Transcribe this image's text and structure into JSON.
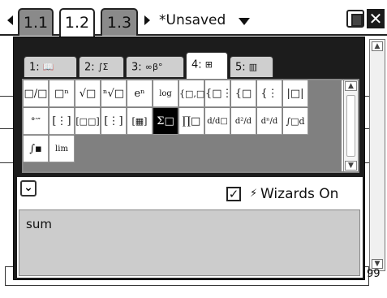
{
  "header": {
    "tabs": [
      {
        "label": "1.1",
        "active": false
      },
      {
        "label": "1.2",
        "active": true
      },
      {
        "label": "1.3",
        "active": false
      }
    ],
    "document_title": "*Unsaved",
    "icons": [
      "nav-left-arrow-icon",
      "nav-right-arrow-icon",
      "dropdown-arrow-icon",
      "battery-icon",
      "close-icon"
    ],
    "close_glyph": "✕"
  },
  "background": {
    "entry_value": "99",
    "scroll_up": "▲",
    "scroll_down": "▼"
  },
  "catalog": {
    "tabs": [
      {
        "number": "1:",
        "icon": "book-icon",
        "glyph": "📖",
        "active": false
      },
      {
        "number": "2:",
        "icon": "integral-sigma-icon",
        "glyph": "∫Σ",
        "active": false
      },
      {
        "number": "3:",
        "icon": "infinity-beta-icon",
        "glyph": "∞β°",
        "active": false
      },
      {
        "number": "4:",
        "icon": "template-icon",
        "glyph": "⊞",
        "active": true
      },
      {
        "number": "5:",
        "icon": "library-icon",
        "glyph": "▥",
        "active": false
      }
    ],
    "templates_row1": [
      {
        "icon": "fraction-template-icon",
        "glyph": "□/□"
      },
      {
        "icon": "exponent-template-icon",
        "glyph": "□ⁿ"
      },
      {
        "icon": "square-root-template-icon",
        "glyph": "√□"
      },
      {
        "icon": "nth-root-template-icon",
        "glyph": "ⁿ√□"
      },
      {
        "icon": "e-exponent-template-icon",
        "glyph": "eⁿ"
      },
      {
        "icon": "log-template-icon",
        "glyph": "log"
      },
      {
        "icon": "piecewise-2-template-icon",
        "glyph": "{□,□"
      },
      {
        "icon": "piecewise-n-template-icon",
        "glyph": "{□⋮"
      },
      {
        "icon": "system-2-template-icon",
        "glyph": "{□"
      },
      {
        "icon": "system-n-template-icon",
        "glyph": "{⋮"
      },
      {
        "icon": "absolute-value-template-icon",
        "glyph": "|□|"
      }
    ],
    "templates_row2": [
      {
        "icon": "degree-minute-second-template-icon",
        "glyph": "°′″"
      },
      {
        "icon": "matrix-2x2-template-icon",
        "glyph": "[⋮]"
      },
      {
        "icon": "row-vector-template-icon",
        "glyph": "[□□]"
      },
      {
        "icon": "column-vector-template-icon",
        "glyph": "[⋮]"
      },
      {
        "icon": "matrix-mxn-template-icon",
        "glyph": "[▦]"
      },
      {
        "icon": "sum-template-icon",
        "glyph": "Σ□",
        "selected": true
      },
      {
        "icon": "product-template-icon",
        "glyph": "∏□"
      },
      {
        "icon": "derivative-template-icon",
        "glyph": "d/d□"
      },
      {
        "icon": "second-derivative-template-icon",
        "glyph": "d²/d"
      },
      {
        "icon": "nth-derivative-template-icon",
        "glyph": "dⁿ/d"
      },
      {
        "icon": "definite-integral-template-icon",
        "glyph": "∫□d"
      }
    ],
    "templates_row3": [
      {
        "icon": "indefinite-integral-template-icon",
        "glyph": "∫▪"
      },
      {
        "icon": "limit-template-icon",
        "glyph": "lim"
      }
    ],
    "wizards": {
      "checked": true,
      "check_glyph": "✓",
      "icon": "wizard-wand-icon",
      "icon_glyph": "⚡",
      "label": "Wizards On"
    },
    "collapse_glyph": "⌄",
    "search_text": "sum"
  }
}
